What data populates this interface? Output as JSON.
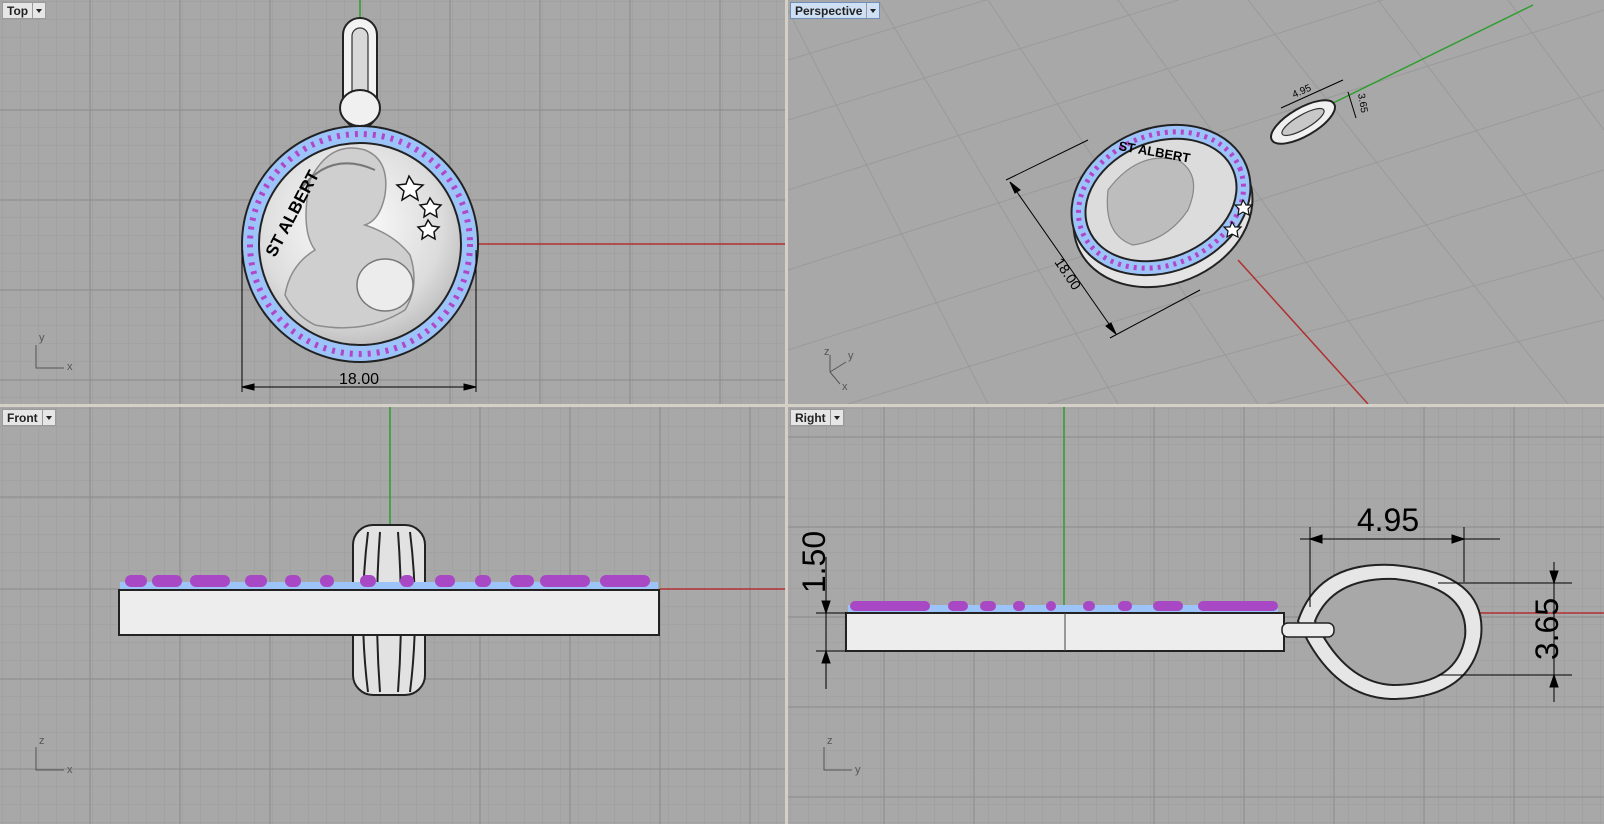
{
  "viewports": {
    "top": {
      "label": "Top",
      "axis_a": "y",
      "axis_b": "x",
      "dim_width": "18.00",
      "medal_text": "ST ALBERT"
    },
    "perspective": {
      "label": "Perspective",
      "axis_z": "z",
      "axis_y": "y",
      "axis_x": "x",
      "dim_diameter": "18.00",
      "dim_loop_w": "4.95",
      "dim_loop_h": "3.65",
      "medal_text": "ST ALBERT"
    },
    "front": {
      "label": "Front",
      "axis_a": "z",
      "axis_b": "x"
    },
    "right": {
      "label": "Right",
      "axis_a": "z",
      "axis_b": "y",
      "dim_thickness": "1.50",
      "dim_loop_w": "4.95",
      "dim_loop_h": "3.65"
    }
  },
  "colors": {
    "viewport_bg": "#a8a8a8",
    "grid_minor": "#9c9c9c",
    "grid_major": "#8a8a8a",
    "axis_x": "#b03030",
    "axis_y": "#2e9e2e",
    "stone_blue": "#8ab4f0",
    "stone_purple": "#a040c0",
    "metal": "#e8e8e8"
  }
}
